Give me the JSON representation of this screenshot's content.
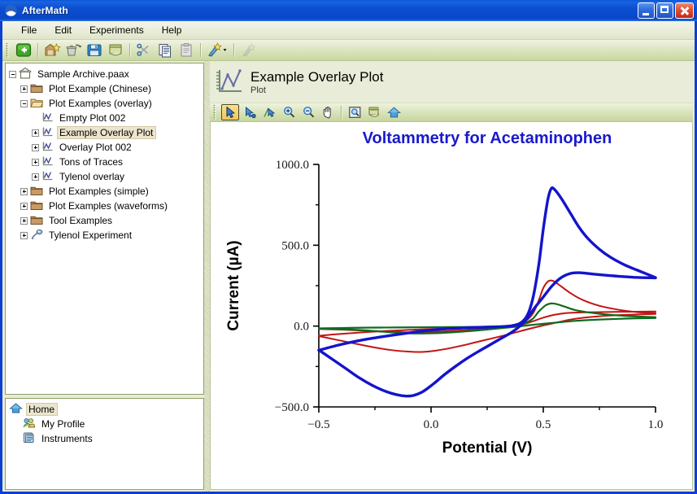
{
  "window": {
    "title": "AfterMath",
    "icon": "aftermath-logo-icon",
    "minimize_label": "Minimize",
    "maximize_label": "Maximize",
    "close_label": "Close"
  },
  "menubar": {
    "items": [
      {
        "label": "File"
      },
      {
        "label": "Edit"
      },
      {
        "label": "Experiments"
      },
      {
        "label": "Help"
      }
    ]
  },
  "toolbar": {
    "buttons": [
      {
        "name": "back-button",
        "icon": "back-arrow-icon",
        "label": "Back"
      },
      {
        "name": "new-archive-button",
        "icon": "new-archive-icon",
        "label": "New Archive"
      },
      {
        "name": "delete-button",
        "icon": "trash-icon",
        "label": "Delete"
      },
      {
        "name": "save-button",
        "icon": "floppy-disk-icon",
        "label": "Save"
      },
      {
        "name": "save-as-button",
        "icon": "save-as-icon",
        "label": "Save As"
      },
      {
        "name": "cut-button",
        "icon": "scissors-icon",
        "label": "Cut"
      },
      {
        "name": "copy-button",
        "icon": "copy-icon",
        "label": "Copy"
      },
      {
        "name": "paste-button",
        "icon": "paste-icon",
        "label": "Paste"
      },
      {
        "name": "new-experiment-button",
        "icon": "magic-wand-dropdown-icon",
        "label": "New Experiment"
      },
      {
        "name": "perform-button",
        "icon": "perform-icon",
        "label": "Perform"
      }
    ]
  },
  "sidebar": {
    "archive_tree": [
      {
        "label": "Sample Archive.paax",
        "icon": "archive-icon",
        "depth": 0,
        "expander": "minus"
      },
      {
        "label": "Plot Example (Chinese)",
        "icon": "folder-closed-icon",
        "depth": 1,
        "expander": "plus"
      },
      {
        "label": "Plot Examples (overlay)",
        "icon": "folder-open-icon",
        "depth": 1,
        "expander": "minus"
      },
      {
        "label": "Empty Plot 002",
        "icon": "plot-icon",
        "depth": 2,
        "expander": "none"
      },
      {
        "label": "Example Overlay Plot",
        "icon": "plot-icon",
        "depth": 2,
        "expander": "plus",
        "selected": true
      },
      {
        "label": "Overlay Plot 002",
        "icon": "plot-icon",
        "depth": 2,
        "expander": "plus"
      },
      {
        "label": "Tons of Traces",
        "icon": "plot-icon",
        "depth": 2,
        "expander": "plus"
      },
      {
        "label": "Tylenol overlay",
        "icon": "plot-icon",
        "depth": 2,
        "expander": "plus"
      },
      {
        "label": "Plot Examples (simple)",
        "icon": "folder-closed-icon",
        "depth": 1,
        "expander": "plus"
      },
      {
        "label": "Plot Examples (waveforms)",
        "icon": "folder-closed-icon",
        "depth": 1,
        "expander": "plus"
      },
      {
        "label": "Tool Examples",
        "icon": "folder-closed-icon",
        "depth": 1,
        "expander": "plus"
      },
      {
        "label": "Tylenol Experiment",
        "icon": "experiment-icon",
        "depth": 1,
        "expander": "plus"
      }
    ],
    "home_tree": [
      {
        "label": "Home",
        "icon": "home-icon",
        "depth": 0,
        "expander": "none",
        "selected": true
      },
      {
        "label": "My Profile",
        "icon": "profile-icon",
        "depth": 1,
        "expander": "none"
      },
      {
        "label": "Instruments",
        "icon": "instruments-icon",
        "depth": 1,
        "expander": "none"
      }
    ]
  },
  "document": {
    "title": "Example Overlay Plot",
    "subtitle": "Plot",
    "icon": "plot-document-icon"
  },
  "plot_toolbar": {
    "buttons": [
      {
        "name": "select-tool",
        "icon": "arrow-select-icon",
        "label": "Select",
        "active": true
      },
      {
        "name": "pick-point-tool",
        "icon": "arrow-point-icon",
        "label": "Pick Point",
        "active": false
      },
      {
        "name": "pick-trace-tool",
        "icon": "arrow-trace-icon",
        "label": "Pick Trace",
        "active": false
      },
      {
        "name": "zoom-in-tool",
        "icon": "zoom-in-icon",
        "label": "Zoom In",
        "active": false
      },
      {
        "name": "zoom-out-tool",
        "icon": "zoom-out-icon",
        "label": "Zoom Out",
        "active": false
      },
      {
        "name": "pan-tool",
        "icon": "hand-pan-icon",
        "label": "Pan",
        "active": false
      },
      {
        "name": "zoom-fit-button",
        "icon": "zoom-fit-icon",
        "label": "Zoom To Fit",
        "active": false
      },
      {
        "name": "print-button",
        "icon": "printer-icon",
        "label": "Print",
        "active": false
      },
      {
        "name": "home-view-button",
        "icon": "home-view-icon",
        "label": "Home View",
        "active": false
      }
    ]
  },
  "chart_data": {
    "type": "line",
    "title": "Voltammetry for Acetaminophen",
    "xlabel": "Potential (V)",
    "ylabel": "Current (µA)",
    "xlim": [
      -0.5,
      1.0
    ],
    "ylim": [
      -500.0,
      1000.0
    ],
    "xticks": [
      -0.5,
      0.0,
      0.5,
      1.0
    ],
    "xtick_labels": [
      "−0.5",
      "0.0",
      "0.5",
      "1.0"
    ],
    "xminor_ticks": [
      -0.25,
      0.25,
      0.75
    ],
    "yticks": [
      -500.0,
      0.0,
      500.0,
      1000.0
    ],
    "ytick_labels": [
      "−500.0",
      "0.0",
      "500.0",
      "1000.0"
    ],
    "yminor_ticks": [
      -250.0,
      250.0,
      750.0
    ],
    "grid": false,
    "legend": "none",
    "series": [
      {
        "name": "blue-cv-forward",
        "color": "#1414cc",
        "width": 3.4,
        "points": [
          [
            -0.5,
            -148
          ],
          [
            -0.44,
            -205
          ],
          [
            -0.38,
            -262
          ],
          [
            -0.32,
            -320
          ],
          [
            -0.26,
            -368
          ],
          [
            -0.2,
            -405
          ],
          [
            -0.14,
            -428
          ],
          [
            -0.09,
            -432
          ],
          [
            -0.04,
            -408
          ],
          [
            0.01,
            -358
          ],
          [
            0.06,
            -300
          ],
          [
            0.11,
            -248
          ],
          [
            0.16,
            -200
          ],
          [
            0.21,
            -158
          ],
          [
            0.26,
            -118
          ],
          [
            0.31,
            -78
          ],
          [
            0.36,
            -38
          ],
          [
            0.4,
            5
          ],
          [
            0.43,
            50
          ],
          [
            0.46,
            110
          ],
          [
            0.5,
            180
          ],
          [
            0.54,
            250
          ],
          [
            0.58,
            300
          ],
          [
            0.62,
            325
          ],
          [
            0.66,
            330
          ],
          [
            0.72,
            322
          ],
          [
            0.8,
            312
          ],
          [
            0.9,
            302
          ],
          [
            1.0,
            298
          ]
        ]
      },
      {
        "name": "blue-cv-reverse",
        "color": "#1414cc",
        "width": 3.4,
        "points": [
          [
            -0.5,
            -150
          ],
          [
            -0.42,
            -120
          ],
          [
            -0.34,
            -95
          ],
          [
            -0.26,
            -75
          ],
          [
            -0.18,
            -58
          ],
          [
            -0.1,
            -42
          ],
          [
            -0.02,
            -28
          ],
          [
            0.06,
            -18
          ],
          [
            0.14,
            -12
          ],
          [
            0.22,
            -8
          ],
          [
            0.3,
            -4
          ],
          [
            0.36,
            2
          ],
          [
            0.4,
            20
          ],
          [
            0.43,
            70
          ],
          [
            0.455,
            180
          ],
          [
            0.48,
            380
          ],
          [
            0.5,
            600
          ],
          [
            0.52,
            780
          ],
          [
            0.535,
            850
          ],
          [
            0.55,
            845
          ],
          [
            0.58,
            790
          ],
          [
            0.62,
            700
          ],
          [
            0.66,
            610
          ],
          [
            0.7,
            540
          ],
          [
            0.75,
            475
          ],
          [
            0.8,
            425
          ],
          [
            0.86,
            380
          ],
          [
            0.92,
            345
          ],
          [
            1.0,
            300
          ]
        ]
      },
      {
        "name": "red-cv-1-forward",
        "color": "#c41414",
        "width": 2.0,
        "points": [
          [
            -0.5,
            -62
          ],
          [
            -0.42,
            -85
          ],
          [
            -0.34,
            -108
          ],
          [
            -0.26,
            -130
          ],
          [
            -0.18,
            -148
          ],
          [
            -0.1,
            -158
          ],
          [
            -0.04,
            -160
          ],
          [
            0.02,
            -152
          ],
          [
            0.08,
            -138
          ],
          [
            0.14,
            -120
          ],
          [
            0.2,
            -100
          ],
          [
            0.26,
            -80
          ],
          [
            0.32,
            -60
          ],
          [
            0.38,
            -38
          ],
          [
            0.44,
            -16
          ],
          [
            0.5,
            4
          ],
          [
            0.56,
            22
          ],
          [
            0.62,
            40
          ],
          [
            0.68,
            52
          ],
          [
            0.76,
            62
          ],
          [
            0.84,
            68
          ],
          [
            0.92,
            72
          ],
          [
            1.0,
            75
          ]
        ]
      },
      {
        "name": "red-cv-1-reverse",
        "color": "#c41414",
        "width": 2.0,
        "points": [
          [
            -0.5,
            -60
          ],
          [
            -0.4,
            -48
          ],
          [
            -0.3,
            -38
          ],
          [
            -0.2,
            -30
          ],
          [
            -0.1,
            -24
          ],
          [
            0.0,
            -18
          ],
          [
            0.1,
            -14
          ],
          [
            0.18,
            -10
          ],
          [
            0.26,
            -6
          ],
          [
            0.33,
            -2
          ],
          [
            0.38,
            8
          ],
          [
            0.42,
            30
          ],
          [
            0.455,
            80
          ],
          [
            0.48,
            160
          ],
          [
            0.5,
            235
          ],
          [
            0.52,
            275
          ],
          [
            0.535,
            282
          ],
          [
            0.55,
            275
          ],
          [
            0.58,
            245
          ],
          [
            0.62,
            205
          ],
          [
            0.66,
            172
          ],
          [
            0.7,
            148
          ],
          [
            0.76,
            122
          ],
          [
            0.84,
            100
          ],
          [
            0.92,
            86
          ],
          [
            1.0,
            80
          ]
        ]
      },
      {
        "name": "red-cv-2",
        "color": "#c41414",
        "width": 2.0,
        "points": [
          [
            -0.5,
            -18
          ],
          [
            -0.4,
            -22
          ],
          [
            -0.3,
            -28
          ],
          [
            -0.2,
            -34
          ],
          [
            -0.12,
            -38
          ],
          [
            -0.04,
            -38
          ],
          [
            0.04,
            -34
          ],
          [
            0.12,
            -28
          ],
          [
            0.2,
            -22
          ],
          [
            0.28,
            -14
          ],
          [
            0.34,
            -6
          ],
          [
            0.4,
            8
          ],
          [
            0.45,
            28
          ],
          [
            0.5,
            52
          ],
          [
            0.55,
            70
          ],
          [
            0.6,
            80
          ],
          [
            0.66,
            84
          ],
          [
            0.74,
            86
          ],
          [
            0.84,
            88
          ],
          [
            1.0,
            90
          ]
        ]
      },
      {
        "name": "green-cv-forward",
        "color": "#0f6b1f",
        "width": 2.2,
        "points": [
          [
            -0.5,
            -16
          ],
          [
            -0.4,
            -20
          ],
          [
            -0.3,
            -26
          ],
          [
            -0.22,
            -34
          ],
          [
            -0.14,
            -42
          ],
          [
            -0.06,
            -46
          ],
          [
            0.02,
            -44
          ],
          [
            0.1,
            -38
          ],
          [
            0.18,
            -30
          ],
          [
            0.26,
            -20
          ],
          [
            0.32,
            -12
          ],
          [
            0.38,
            -4
          ],
          [
            0.44,
            6
          ],
          [
            0.5,
            14
          ],
          [
            0.56,
            22
          ],
          [
            0.64,
            32
          ],
          [
            0.74,
            40
          ],
          [
            0.86,
            46
          ],
          [
            1.0,
            50
          ]
        ]
      },
      {
        "name": "green-cv-reverse",
        "color": "#0f6b1f",
        "width": 2.2,
        "points": [
          [
            -0.5,
            -14
          ],
          [
            -0.4,
            -12
          ],
          [
            -0.3,
            -10
          ],
          [
            -0.2,
            -9
          ],
          [
            -0.1,
            -8
          ],
          [
            0.0,
            -7
          ],
          [
            0.1,
            -6
          ],
          [
            0.2,
            -5
          ],
          [
            0.28,
            -3
          ],
          [
            0.34,
            0
          ],
          [
            0.4,
            10
          ],
          [
            0.45,
            42
          ],
          [
            0.48,
            90
          ],
          [
            0.51,
            128
          ],
          [
            0.535,
            140
          ],
          [
            0.56,
            136
          ],
          [
            0.6,
            118
          ],
          [
            0.64,
            100
          ],
          [
            0.7,
            85
          ],
          [
            0.78,
            72
          ],
          [
            0.88,
            62
          ],
          [
            1.0,
            55
          ]
        ]
      }
    ]
  }
}
